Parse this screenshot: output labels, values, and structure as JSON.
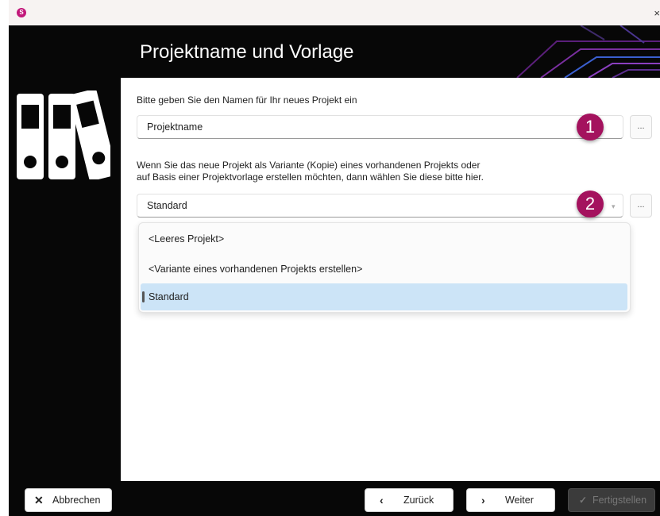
{
  "window": {
    "app_icon": "app-logo-icon",
    "close_label": "×"
  },
  "header": {
    "title": "Projektname und Vorlage"
  },
  "form": {
    "name_prompt": "Bitte geben Sie den Namen für Ihr neues Projekt ein",
    "name_value": "Projektname",
    "variant_prompt_line1": "Wenn Sie das neue Projekt als Variante (Kopie) eines vorhandenen Projekts oder",
    "variant_prompt_line2": "auf Basis einer Projektvorlage erstellen möchten, dann wählen Sie diese bitte hier.",
    "template_selected": "Standard",
    "browse_label": "...",
    "options": [
      "<Leeres Projekt>",
      "<Variante eines vorhandenen Projekts erstellen>",
      "Standard"
    ]
  },
  "badges": {
    "one": "1",
    "two": "2"
  },
  "footer": {
    "cancel": "Abbrechen",
    "back": "Zurück",
    "next": "Weiter",
    "finish": "Fertigstellen"
  },
  "colors": {
    "accent": "#a4125e",
    "selected_option": "#cce4f7",
    "dark_bg": "#070707"
  }
}
